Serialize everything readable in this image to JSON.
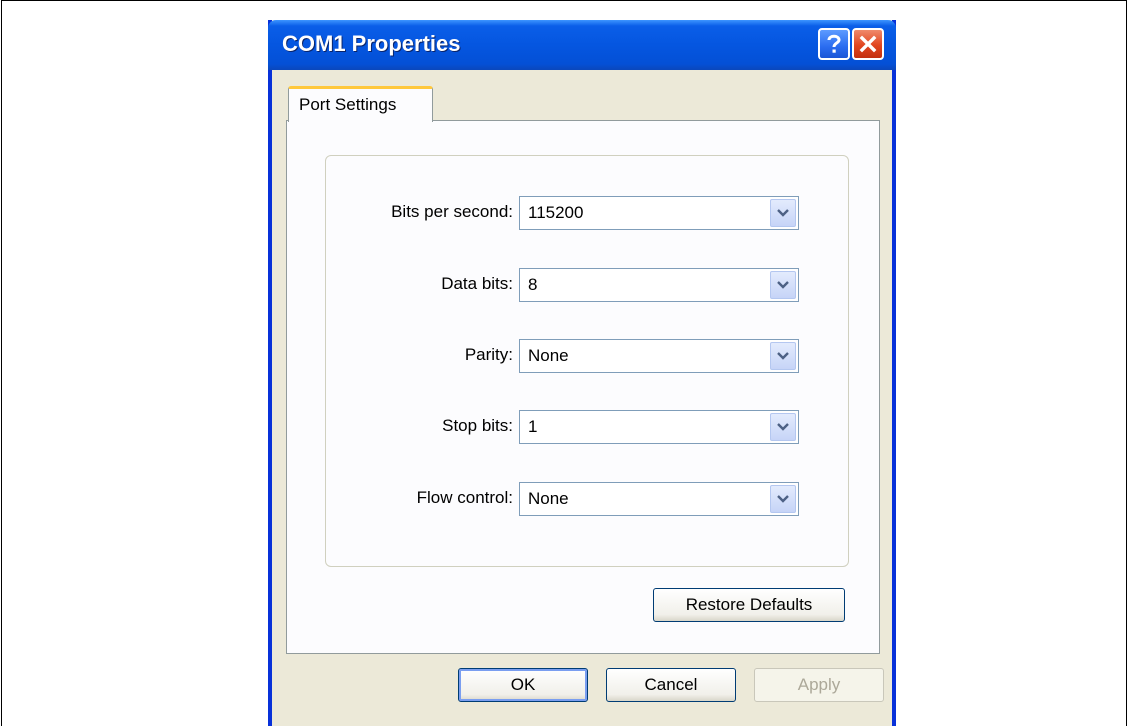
{
  "window": {
    "title": "COM1 Properties",
    "help_icon": "question-mark-icon",
    "close_icon": "close-x-icon"
  },
  "tabs": [
    {
      "label": "Port Settings",
      "active": true
    }
  ],
  "settings": [
    {
      "label": "Bits per second:",
      "value": "115200"
    },
    {
      "label": "Data bits:",
      "value": "8"
    },
    {
      "label": "Parity:",
      "value": "None"
    },
    {
      "label": "Stop bits:",
      "value": "1"
    },
    {
      "label": "Flow control:",
      "value": "None"
    }
  ],
  "buttons": {
    "restore_defaults": "Restore Defaults",
    "ok": "OK",
    "cancel": "Cancel",
    "apply": "Apply"
  },
  "colors": {
    "titlebar": "#0556e0",
    "dialog_bg": "#ece9d8",
    "tab_highlight": "#ffc83c"
  }
}
